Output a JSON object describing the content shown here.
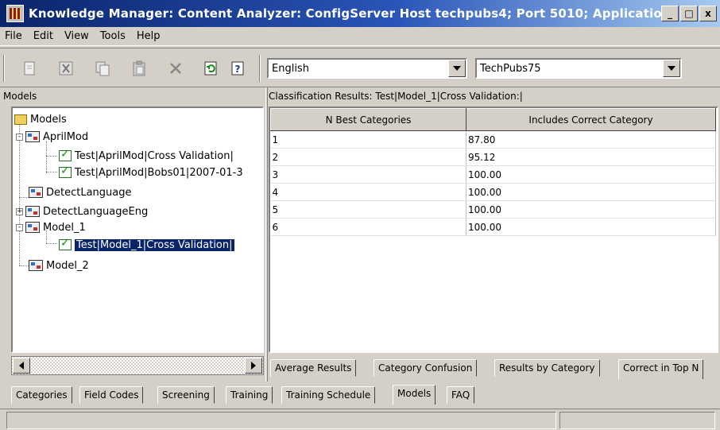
{
  "window": {
    "title": "Knowledge Manager: Content Analyzer: ConfigServer Host techpubs4; Port 5010; Application Davi...",
    "min_label": "_",
    "max_label": "□",
    "close_label": "x"
  },
  "menu": [
    "File",
    "Edit",
    "View",
    "Tools",
    "Help"
  ],
  "toolbar": {
    "icons": [
      "new-document-icon",
      "cut-icon",
      "copy-icon",
      "paste-icon",
      "delete-icon",
      "refresh-icon",
      "help-icon"
    ],
    "language_value": "English",
    "server_value": "TechPubs75"
  },
  "left": {
    "header": "Models",
    "tree": [
      {
        "label": "Models",
        "icon": "folder-icon"
      },
      {
        "label": "AprilMod",
        "icon": "model-icon",
        "expand": "-"
      },
      {
        "label": "Test|AprilMod|Cross Validation|",
        "icon": "check-icon"
      },
      {
        "label": "Test|AprilMod|Bobs01|2007-01-3",
        "icon": "check-icon"
      },
      {
        "label": "DetectLanguage",
        "icon": "model-icon"
      },
      {
        "label": "DetectLanguageEng",
        "icon": "model-icon",
        "expand": "+"
      },
      {
        "label": "Model_1",
        "icon": "model-icon",
        "expand": "-"
      },
      {
        "label": "Test|Model_1|Cross Validation|",
        "icon": "check-icon",
        "selected": true
      },
      {
        "label": "Model_2",
        "icon": "model-icon"
      }
    ]
  },
  "right": {
    "header": "Classification Results: Test|Model_1|Cross Validation:|",
    "columns": [
      "N Best Categories",
      "Includes Correct Category"
    ],
    "rows": [
      [
        "1",
        "87.80"
      ],
      [
        "2",
        "95.12"
      ],
      [
        "3",
        "100.00"
      ],
      [
        "4",
        "100.00"
      ],
      [
        "5",
        "100.00"
      ],
      [
        "6",
        "100.00"
      ]
    ],
    "result_tabs": [
      "Average Results",
      "Category Confusion",
      "Results by Category",
      "Correct in Top N"
    ],
    "active_result_tab": 3
  },
  "main_tabs": [
    "Categories",
    "Field Codes",
    "Screening",
    "Training",
    "Training Schedule",
    "Models",
    "FAQ"
  ],
  "active_main_tab": 5
}
